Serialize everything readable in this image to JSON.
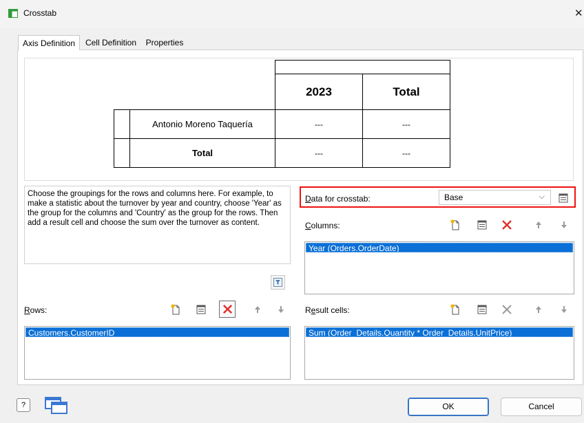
{
  "window": {
    "title": "Crosstab",
    "close_glyph": "✕"
  },
  "tabs": [
    {
      "label": "Axis Definition",
      "active": true
    },
    {
      "label": "Cell Definition",
      "active": false
    },
    {
      "label": "Properties",
      "active": false
    }
  ],
  "preview": {
    "year_header": "2023",
    "total_header": "Total",
    "row_label": "Antonio Moreno Taquería",
    "total_row_label": "Total",
    "placeholder": "---"
  },
  "help_text": "Choose the groupings for the rows and columns here. For example, to make a statistic about the turnover by year and country, choose 'Year' as the group for the columns and 'Country' as the group for the rows. Then add a result cell and choose the sum over the turnover as content.",
  "data_for_crosstab": {
    "label_accel": "D",
    "label_rest": "ata for crosstab:",
    "value": "Base"
  },
  "columns": {
    "label_accel": "C",
    "label_rest": "olumns:",
    "items": [
      "Year (Orders.OrderDate)"
    ]
  },
  "rows": {
    "label_accel": "R",
    "label_rest": "ows:",
    "items": [
      "Customers.CustomerID"
    ]
  },
  "result_cells": {
    "label_pre": "R",
    "label_accel": "e",
    "label_rest": "sult cells:",
    "items": [
      "Sum (Order_Details.Quantity * Order_Details.UnitPrice)"
    ]
  },
  "buttons": {
    "ok": "OK",
    "cancel": "Cancel",
    "help": "?"
  },
  "colors": {
    "accent": "#0a6fd6",
    "delete_red": "#e0302a",
    "highlight_border": "#ee1111",
    "ok_border": "#3673c4"
  },
  "icons": [
    "crosstab-app-icon",
    "new-item-icon",
    "properties-icon",
    "delete-icon",
    "move-up-icon",
    "move-down-icon",
    "filter-icon",
    "help-icon",
    "windows-icon",
    "chevron-down-icon"
  ]
}
